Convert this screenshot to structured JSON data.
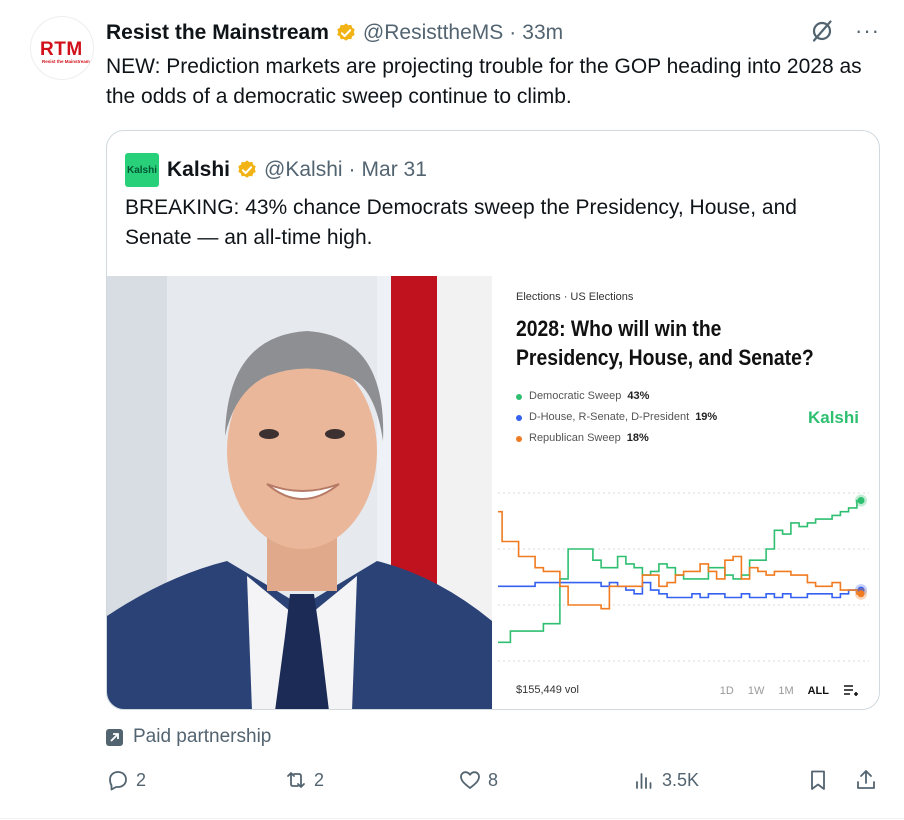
{
  "tweet": {
    "author_name": "Resist the Mainstream",
    "handle": "@ResisttheMS",
    "separator": "·",
    "time": "33m",
    "avatar_text": "RTM",
    "avatar_subtext": "Resist the Mainstream",
    "text": "NEW: Prediction markets are projecting trouble for the GOP heading into 2028 as the odds of a democratic sweep continue to climb."
  },
  "quote": {
    "author_name": "Kalshi",
    "handle": "@Kalshi",
    "separator": "·",
    "date": "Mar 31",
    "avatar_text": "Kalshi",
    "text": "BREAKING: 43% chance Democrats sweep the Presidency, House, and Senate — an all-time high."
  },
  "card": {
    "breadcrumb": "Elections  ·  US Elections",
    "title": "2028: Who will win the Presidency, House, and Senate?",
    "brand": "Kalshi",
    "volume": "$155,449 vol",
    "ranges": [
      "1D",
      "1W",
      "1M",
      "ALL"
    ],
    "active_range": "ALL"
  },
  "chart_data": {
    "type": "line",
    "title": "2028: Who will win the Presidency, House, and Senate?",
    "series": [
      {
        "name": "Democratic Sweep",
        "label": "43%",
        "color": "#2fbf71",
        "values": [
          5,
          5,
          8,
          8,
          8,
          8,
          10,
          10,
          22,
          30,
          30,
          30,
          27,
          25,
          25,
          28,
          26,
          25,
          23,
          24,
          26,
          25,
          23,
          22,
          22,
          22,
          25,
          25,
          23,
          22,
          23,
          27,
          27,
          30,
          35,
          34,
          37,
          36,
          37,
          38,
          38,
          39,
          40,
          41,
          43
        ]
      },
      {
        "name": "D-House, R-Senate, D-President",
        "label": "19%",
        "color": "#3461f0",
        "values": [
          20,
          20,
          20,
          20,
          20,
          21,
          21,
          21,
          21,
          21,
          21,
          21,
          21,
          20,
          21,
          20,
          19,
          18,
          21,
          19,
          18,
          17,
          17,
          17,
          18,
          17,
          18,
          18,
          17,
          17,
          18,
          17,
          17,
          18,
          17,
          18,
          17,
          17,
          18,
          18,
          18,
          17,
          18,
          19,
          19
        ]
      },
      {
        "name": "Republican Sweep",
        "label": "18%",
        "color": "#f07b20",
        "values": [
          40,
          32,
          32,
          28,
          28,
          25,
          24,
          24,
          20,
          15,
          15,
          15,
          15,
          14,
          20,
          20,
          20,
          20,
          23,
          23,
          20,
          21,
          23,
          24,
          24,
          26,
          24,
          22,
          27,
          28,
          22,
          25,
          24,
          23,
          24,
          24,
          23,
          23,
          21,
          20,
          20,
          21,
          19,
          19,
          18
        ]
      }
    ],
    "ylim": [
      0,
      45
    ],
    "grid": true
  },
  "paid_partnership": "Paid partnership",
  "actions": {
    "replies": "2",
    "reposts": "2",
    "likes": "8",
    "views": "3.5K"
  },
  "colors": {
    "verified": "#f2b314",
    "text_secondary": "#536471",
    "border": "#cfd9de"
  }
}
